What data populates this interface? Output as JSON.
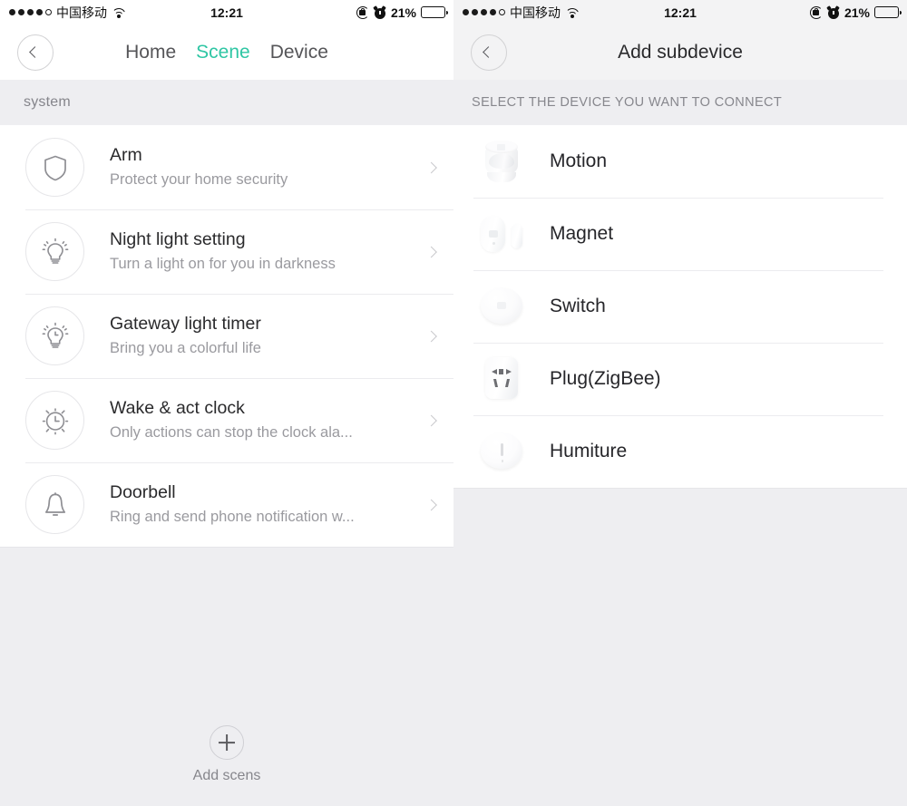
{
  "status_bar": {
    "signal_dots_filled": 4,
    "signal_dots_total": 5,
    "carrier": "中国移动",
    "wifi_icon": "wifi-icon",
    "time": "12:21",
    "rotation_lock_icon": "rotation-lock-icon",
    "alarm_icon": "alarm-clock-icon",
    "battery_percent": "21%",
    "battery_level": 21
  },
  "left_phone": {
    "back_icon": "chevron-left-icon",
    "tabs": [
      {
        "label": "Home",
        "active": false
      },
      {
        "label": "Scene",
        "active": true
      },
      {
        "label": "Device",
        "active": false
      }
    ],
    "active_tab_color": "#2fc6a4",
    "section_label": "system",
    "scenes": [
      {
        "icon": "shield-icon",
        "title": "Arm",
        "subtitle": "Protect your home security",
        "chevron": "chevron-right-icon"
      },
      {
        "icon": "light-bulb-icon",
        "title": "Night light setting",
        "subtitle": "Turn a light on for you in darkness",
        "chevron": "chevron-right-icon"
      },
      {
        "icon": "light-bulb-timer-icon",
        "title": "Gateway light timer",
        "subtitle": "Bring you a colorful life",
        "chevron": "chevron-right-icon"
      },
      {
        "icon": "alarm-clock-icon",
        "title": "Wake & act clock",
        "subtitle": "Only actions can stop the clock ala...",
        "chevron": "chevron-right-icon"
      },
      {
        "icon": "bell-icon",
        "title": "Doorbell",
        "subtitle": "Ring and send phone notification w...",
        "chevron": "chevron-right-icon"
      }
    ],
    "footer": {
      "add_icon": "plus-circle-icon",
      "add_label": "Add scens"
    }
  },
  "right_phone": {
    "back_icon": "chevron-left-icon",
    "title": "Add subdevice",
    "section_label": "SELECT THE DEVICE YOU WANT TO CONNECT",
    "devices": [
      {
        "thumb": "motion-sensor-photo",
        "label": "Motion"
      },
      {
        "thumb": "magnet-sensor-photo",
        "label": "Magnet"
      },
      {
        "thumb": "switch-button-photo",
        "label": "Switch"
      },
      {
        "thumb": "zigbee-plug-photo",
        "label": "Plug(ZigBee)"
      },
      {
        "thumb": "humiture-sensor-photo",
        "label": "Humiture"
      }
    ]
  },
  "theme": {
    "page_background": "#eeeef1",
    "panel_background": "#ffffff",
    "accent": "#2fc6a4",
    "title_text": "#2a2a2c",
    "secondary_text": "#9a9a9f",
    "divider": "#ebebee"
  }
}
